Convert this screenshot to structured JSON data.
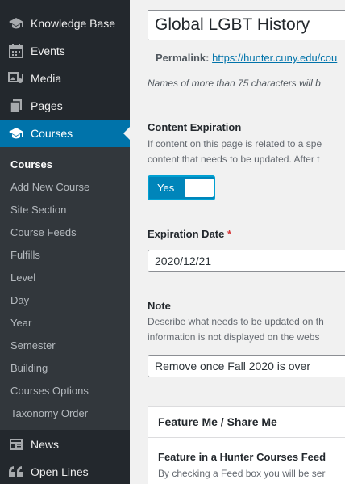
{
  "sidebar": {
    "menu": [
      {
        "label": "Knowledge Base",
        "icon": "graduation-cap-icon"
      },
      {
        "label": "Events",
        "icon": "calendar-icon"
      },
      {
        "label": "Media",
        "icon": "media-icon"
      },
      {
        "label": "Pages",
        "icon": "pages-icon"
      },
      {
        "label": "Courses",
        "icon": "graduation-cap-icon"
      }
    ],
    "submenu": [
      "Courses",
      "Add New Course",
      "Site Section",
      "Course Feeds",
      "Fulfills",
      "Level",
      "Day",
      "Year",
      "Semester",
      "Building",
      "Courses Options",
      "Taxonomy Order"
    ],
    "menu_after": [
      {
        "label": "News",
        "icon": "news-icon"
      },
      {
        "label": "Open Lines",
        "icon": "quote-icon"
      }
    ]
  },
  "editor": {
    "title": "Global LGBT History",
    "permalink_label": "Permalink:",
    "permalink_url": "https://hunter.cuny.edu/cou",
    "title_hint": "Names of more than 75 characters will b",
    "content_expiration": {
      "label": "Content Expiration",
      "desc_line1": "If content on this page is related to a spe",
      "desc_line2": "content that needs to be updated. After t",
      "toggle_label": "Yes"
    },
    "expiration_date": {
      "label": "Expiration Date",
      "required": "*",
      "value": "2020/12/21"
    },
    "note": {
      "label": "Note",
      "desc_line1": "Describe what needs to be updated on th",
      "desc_line2": "information is not displayed on the webs",
      "value": "Remove once Fall 2020 is over"
    },
    "feature_box": {
      "title": "Feature Me / Share Me",
      "subtitle": "Feature in a Hunter Courses Feed",
      "desc": "By checking a Feed box you will be ser"
    }
  },
  "colors": {
    "sidebar_bg": "#23282d",
    "submenu_bg": "#32373c",
    "active": "#0073aa",
    "toggle": "#0085ba"
  }
}
